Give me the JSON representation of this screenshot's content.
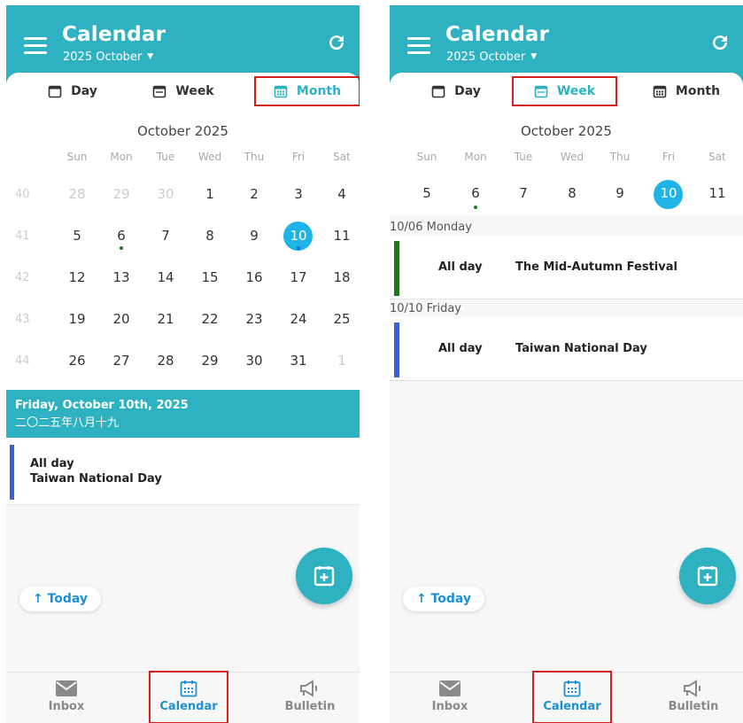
{
  "app": {
    "title": "Calendar",
    "month_selector": "2025 October",
    "colors": {
      "header": "#2eb2c2",
      "today": "#1fb4e8",
      "link": "#1c8fd6",
      "highlight_box": "#d62020"
    }
  },
  "view_tabs": [
    "Day",
    "Week",
    "Month"
  ],
  "calendar": {
    "title": "October 2025",
    "weekdays": [
      "Sun",
      "Mon",
      "Tue",
      "Wed",
      "Thu",
      "Fri",
      "Sat"
    ],
    "weeks": [
      {
        "num": "40",
        "days": [
          "28",
          "29",
          "30",
          "1",
          "2",
          "3",
          "4"
        ]
      },
      {
        "num": "41",
        "days": [
          "5",
          "6",
          "7",
          "8",
          "9",
          "10",
          "11"
        ]
      },
      {
        "num": "42",
        "days": [
          "12",
          "13",
          "14",
          "15",
          "16",
          "17",
          "18"
        ]
      },
      {
        "num": "43",
        "days": [
          "19",
          "20",
          "21",
          "22",
          "23",
          "24",
          "25"
        ]
      },
      {
        "num": "44",
        "days": [
          "26",
          "27",
          "28",
          "29",
          "30",
          "31",
          "1"
        ]
      }
    ],
    "week_view_days": [
      "5",
      "6",
      "7",
      "8",
      "9",
      "10",
      "11"
    ],
    "selected_day": "10"
  },
  "left_screen": {
    "active_tab": "Month",
    "selected_date": "Friday, October 10th, 2025",
    "lunar_date": "二〇二五年八月十九",
    "event": {
      "time": "All day",
      "name": "Taiwan National Day"
    }
  },
  "right_screen": {
    "active_tab": "Week",
    "groups": [
      {
        "label": "10/06 Monday",
        "time": "All day",
        "name": "The Mid-Autumn Festival",
        "color": "#1a7a1a"
      },
      {
        "label": "10/10 Friday",
        "time": "All day",
        "name": "Taiwan National Day",
        "color": "#3a5fd6"
      }
    ]
  },
  "today_button": "↑ Today",
  "bottom_nav": [
    "Inbox",
    "Calendar",
    "Bulletin"
  ],
  "bottom_nav_active": "Calendar"
}
